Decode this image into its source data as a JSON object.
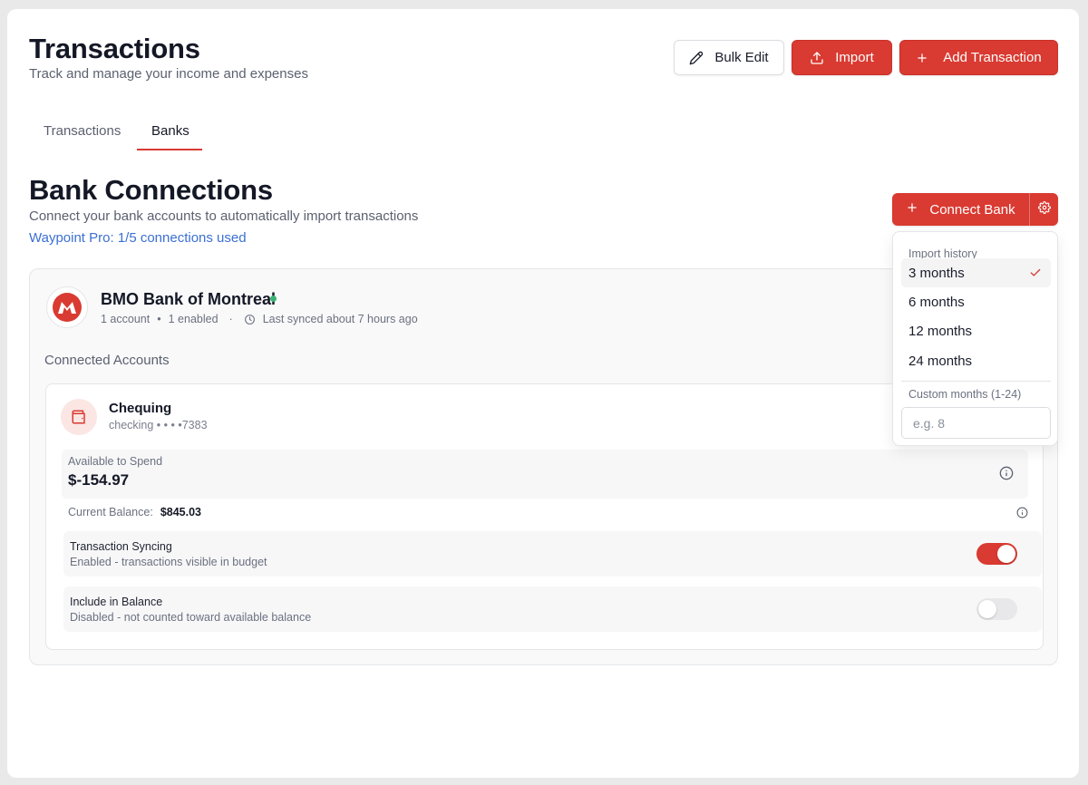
{
  "header": {
    "title": "Transactions",
    "subtitle": "Track and manage your income and expenses",
    "bulk_edit_label": "Bulk Edit",
    "import_label": "Import",
    "add_label": "Add Transaction"
  },
  "tabs": [
    {
      "label": "Transactions",
      "active": false
    },
    {
      "label": "Banks",
      "active": true
    }
  ],
  "section": {
    "title": "Bank Connections",
    "description": "Connect your bank accounts to automatically import transactions",
    "plan_usage": "Waypoint Pro: 1/5 connections used",
    "connect_label": "Connect Bank"
  },
  "bank": {
    "name": "BMO Bank of Montreal",
    "accounts": "1 account",
    "enabled": "1 enabled",
    "last_synced": "Last synced about 7 hours ago",
    "status_color": "#3bb273",
    "connected_label": "Connected Accounts"
  },
  "account": {
    "name": "Chequing",
    "type_line": "checking • • • •7383",
    "available_label": "Available to Spend",
    "available_value": "$-154.97",
    "current_label": "Current Balance:",
    "current_value": "$845.03",
    "syncing_title": "Transaction Syncing",
    "syncing_desc": "Enabled - transactions visible in budget",
    "syncing_on": true,
    "include_title": "Include in Balance",
    "include_desc": "Disabled - not counted toward available balance",
    "include_on": false
  },
  "dropdown": {
    "heading": "Import history",
    "options": [
      "3 months",
      "6 months",
      "12 months",
      "24 months"
    ],
    "selected": "3 months",
    "custom_label": "Custom months (1-24)",
    "custom_placeholder": "e.g. 8",
    "custom_value": ""
  },
  "colors": {
    "accent": "#d93a31",
    "link": "#3b6fd4"
  }
}
